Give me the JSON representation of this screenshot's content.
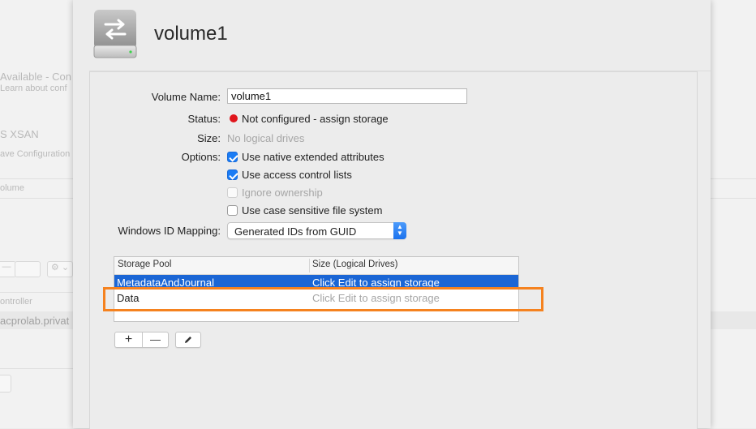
{
  "background": {
    "texts": [
      "Available - Con",
      "Learn about conf",
      "S XSAN",
      "ave Configuration",
      "olume",
      "ontroller",
      "acprolab.privat"
    ],
    "buttons": [
      "—",
      "⚙ ⌄"
    ]
  },
  "header": {
    "title": "volume1",
    "icon": "external-drive-icon"
  },
  "form": {
    "volume_name_label": "Volume Name:",
    "volume_name_value": "volume1",
    "status_label": "Status:",
    "status_value": "Not configured - assign storage",
    "status_color": "#e0151c",
    "size_label": "Size:",
    "size_value": "No logical drives",
    "options_label": "Options:",
    "options": [
      {
        "label": "Use native extended attributes",
        "checked": true,
        "enabled": true
      },
      {
        "label": "Use access control lists",
        "checked": true,
        "enabled": true
      },
      {
        "label": "Ignore ownership",
        "checked": false,
        "enabled": false
      },
      {
        "label": "Use case sensitive file system",
        "checked": false,
        "enabled": true
      }
    ],
    "windows_id_label": "Windows ID Mapping:",
    "windows_id_value": "Generated IDs from GUID"
  },
  "storage_table": {
    "columns": [
      "Storage Pool",
      "Size (Logical Drives)"
    ],
    "rows": [
      {
        "pool": "MetadataAndJournal",
        "size": "Click Edit to assign storage",
        "selected": true
      },
      {
        "pool": "Data",
        "size": "Click Edit to assign storage",
        "selected": false
      }
    ]
  },
  "toolbar": {
    "add_label": "+",
    "remove_label": "—",
    "edit_icon": "pencil-icon"
  },
  "colors": {
    "accent": "#1b66d5",
    "highlight": "#f5821f"
  }
}
